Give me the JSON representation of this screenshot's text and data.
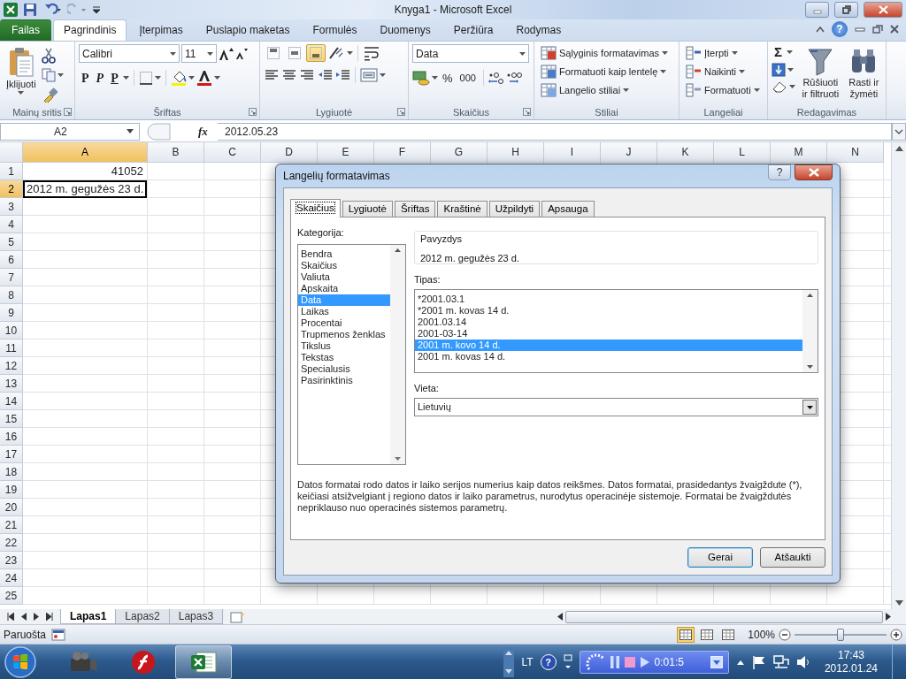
{
  "window": {
    "title": "Knyga1 - Microsoft Excel"
  },
  "ribbon_tabs": [
    {
      "label": "Failas",
      "kind": "file",
      "selected": false
    },
    {
      "label": "Pagrindinis",
      "kind": "tab",
      "selected": true
    },
    {
      "label": "Įterpimas",
      "kind": "tab",
      "selected": false
    },
    {
      "label": "Puslapio maketas",
      "kind": "tab",
      "selected": false
    },
    {
      "label": "Formulės",
      "kind": "tab",
      "selected": false
    },
    {
      "label": "Duomenys",
      "kind": "tab",
      "selected": false
    },
    {
      "label": "Peržiūra",
      "kind": "tab",
      "selected": false
    },
    {
      "label": "Rodymas",
      "kind": "tab",
      "selected": false
    }
  ],
  "ribbon_help": "?",
  "ribbon": {
    "paste": "Įklijuoti",
    "clipboard_group": "Mainų sritis",
    "font_name": "Calibri",
    "font_size": "11",
    "bold": "P",
    "italic": "P",
    "underline": "P",
    "font_group": "Šriftas",
    "alignment_buttons": [
      {
        "selected": false
      },
      {
        "selected": false
      },
      {
        "selected": true
      }
    ],
    "alignment_group": "Lygiuotė",
    "number_format": "Data",
    "percent": "%",
    "thousands": "000",
    "number_group": "Skaičius",
    "conditional_formatting": "Sąlyginis formatavimas",
    "format_as_table": "Formatuoti kaip lentelę",
    "cell_styles": "Langelio stiliai",
    "styles_group": "Stiliai",
    "insert": "Įterpti",
    "delete": "Naikinti",
    "format": "Formatuoti",
    "cells_group": "Langeliai",
    "autosum": "Σ",
    "sort_filter": "Rūšiuoti ir filtruoti",
    "find_select": "Rasti ir žymėti",
    "editing_group": "Redagavimas"
  },
  "formula_bar": {
    "name_box": "A2",
    "function_label": "fx",
    "formula": "2012.05.23"
  },
  "sheet": {
    "columns": [
      "A",
      "B",
      "C",
      "D",
      "E",
      "F",
      "G",
      "H",
      "I",
      "J",
      "K",
      "L",
      "M",
      "N"
    ],
    "rows": [
      {
        "number": "1",
        "value": "41052",
        "kind": "number",
        "selected": false
      },
      {
        "number": "2",
        "value": "2012 m. gegužės 23 d.",
        "kind": "text",
        "selected": true
      },
      {
        "number": "3",
        "selected": false
      },
      {
        "number": "4",
        "selected": false
      },
      {
        "number": "5",
        "selected": false
      },
      {
        "number": "6",
        "selected": false
      },
      {
        "number": "7",
        "selected": false
      },
      {
        "number": "8",
        "selected": false
      },
      {
        "number": "9",
        "selected": false
      },
      {
        "number": "10",
        "selected": false
      },
      {
        "number": "11",
        "selected": false
      },
      {
        "number": "12",
        "selected": false
      },
      {
        "number": "13",
        "selected": false
      },
      {
        "number": "14",
        "selected": false
      },
      {
        "number": "15",
        "selected": false
      },
      {
        "number": "16",
        "selected": false
      },
      {
        "number": "17",
        "selected": false
      },
      {
        "number": "18",
        "selected": false
      },
      {
        "number": "19",
        "selected": false
      },
      {
        "number": "20",
        "selected": false
      },
      {
        "number": "21",
        "selected": false
      },
      {
        "number": "22",
        "selected": false
      },
      {
        "number": "23",
        "selected": false
      },
      {
        "number": "24",
        "selected": false
      },
      {
        "number": "25",
        "selected": false
      }
    ]
  },
  "dialog": {
    "title": "Langelių formatavimas",
    "help": "?",
    "tabs": [
      {
        "label": "Skaičius",
        "selected": true
      },
      {
        "label": "Lygiuotė",
        "selected": false
      },
      {
        "label": "Šriftas",
        "selected": false
      },
      {
        "label": "Kraštinė",
        "selected": false
      },
      {
        "label": "Užpildyti",
        "selected": false
      },
      {
        "label": "Apsauga",
        "selected": false
      }
    ],
    "category_label": "Kategorija:",
    "categories": [
      {
        "label": "Bendra",
        "selected": false
      },
      {
        "label": "Skaičius",
        "selected": false
      },
      {
        "label": "Valiuta",
        "selected": false
      },
      {
        "label": "Apskaita",
        "selected": false
      },
      {
        "label": "Data",
        "selected": true
      },
      {
        "label": "Laikas",
        "selected": false
      },
      {
        "label": "Procentai",
        "selected": false
      },
      {
        "label": "Trupmenos ženklas",
        "selected": false
      },
      {
        "label": "Tikslus",
        "selected": false
      },
      {
        "label": "Tekstas",
        "selected": false
      },
      {
        "label": "Specialusis",
        "selected": false
      },
      {
        "label": "Pasirinktinis",
        "selected": false
      }
    ],
    "sample_label": "Pavyzdys",
    "sample": "2012 m. gegužės 23 d.",
    "type_label": "Tipas:",
    "types": [
      {
        "label": "*2001.03.1",
        "selected": false
      },
      {
        "label": "*2001 m. kovas 14 d.",
        "selected": false
      },
      {
        "label": "2001.03.14",
        "selected": false
      },
      {
        "label": "2001-03-14",
        "selected": false
      },
      {
        "label": "2001 m. kovo 14 d.",
        "selected": true
      },
      {
        "label": "2001 m. kovas 14 d.",
        "selected": false
      }
    ],
    "locale_label": "Vieta:",
    "locale": "Lietuvių",
    "description": "Datos formatai rodo datos ir laiko serijos numerius kaip datos reikšmes. Datos formatai, prasidedantys žvaigždute (*), keičiasi atsižvelgiant į regiono datos ir laiko parametrus, nurodytus operacinėje sistemoje. Formatai be žvaigždutės nepriklauso nuo operacinės sistemos parametrų.",
    "buttons": [
      "Gerai",
      "Atšaukti"
    ]
  },
  "sheet_tabs": [
    {
      "label": "Lapas1",
      "selected": true
    },
    {
      "label": "Lapas2",
      "selected": false
    },
    {
      "label": "Lapas3",
      "selected": false
    }
  ],
  "status_bar": {
    "status": "Paruošta",
    "views": [
      {
        "selected": true
      },
      {
        "selected": false
      },
      {
        "selected": false
      }
    ],
    "zoom": "100%",
    "zoom_slider": {
      "level": 0.5
    }
  },
  "taskbar": {
    "language": "LT",
    "help": "?",
    "recorder_time": "0:01:5",
    "time": "17:43",
    "date": "2012.01.24"
  }
}
